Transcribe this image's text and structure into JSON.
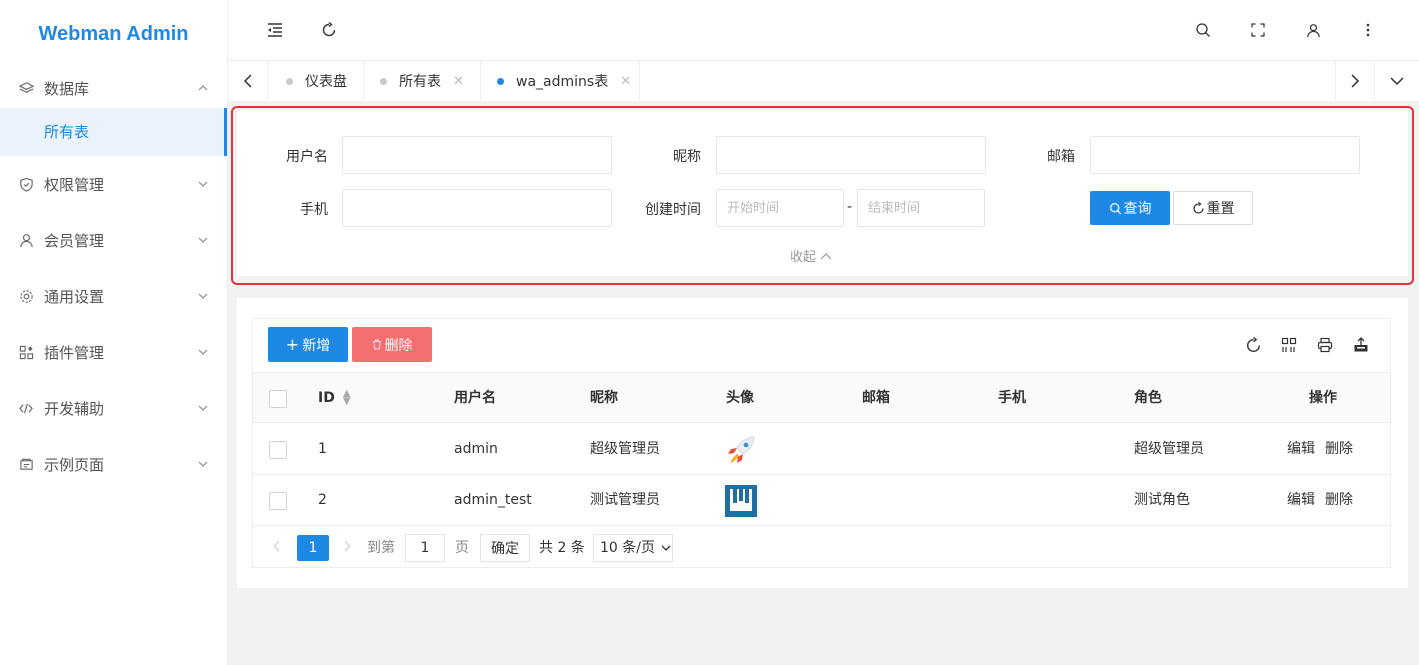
{
  "app": {
    "title": "Webman Admin"
  },
  "sidebar": {
    "items": [
      {
        "label": "数据库",
        "icon": "layers-icon",
        "expanded": true
      },
      {
        "label": "所有表",
        "sub": true,
        "active": true
      },
      {
        "label": "权限管理",
        "icon": "shield-icon"
      },
      {
        "label": "会员管理",
        "icon": "user-icon"
      },
      {
        "label": "通用设置",
        "icon": "gear-icon"
      },
      {
        "label": "插件管理",
        "icon": "plugin-icon"
      },
      {
        "label": "开发辅助",
        "icon": "code-icon"
      },
      {
        "label": "示例页面",
        "icon": "page-icon"
      }
    ]
  },
  "header": {
    "icons": [
      "menu-fold-icon",
      "refresh-icon",
      "search-icon",
      "fullscreen-icon",
      "user-icon",
      "more-icon"
    ]
  },
  "tabs": [
    {
      "label": "仪表盘",
      "closable": false,
      "active": false
    },
    {
      "label": "所有表",
      "closable": true,
      "active": false
    },
    {
      "label": "wa_admins表",
      "closable": true,
      "active": true
    }
  ],
  "search": {
    "username_label": "用户名",
    "nickname_label": "昵称",
    "email_label": "邮箱",
    "mobile_label": "手机",
    "created_label": "创建时间",
    "start_placeholder": "开始时间",
    "end_placeholder": "结束时间",
    "dash": "-",
    "query_label": "查询",
    "reset_label": "重置",
    "collapse_label": "收起"
  },
  "toolbar": {
    "add_label": "新增",
    "delete_label": "删除"
  },
  "table": {
    "columns": [
      "ID",
      "用户名",
      "昵称",
      "头像",
      "邮箱",
      "手机",
      "角色",
      "操作"
    ],
    "rows": [
      {
        "id": "1",
        "username": "admin",
        "nickname": "超级管理员",
        "avatar": "rocket-avatar",
        "email": "",
        "mobile": "",
        "role": "超级管理员"
      },
      {
        "id": "2",
        "username": "admin_test",
        "nickname": "测试管理员",
        "avatar": "plug-avatar",
        "email": "",
        "mobile": "",
        "role": "测试角色"
      }
    ],
    "edit_label": "编辑",
    "delete_label": "删除"
  },
  "pagination": {
    "current": "1",
    "goto_label": "到第",
    "goto_value": "1",
    "page_label": "页",
    "confirm_label": "确定",
    "total_label": "共 2 条",
    "per_page_label": "10 条/页"
  },
  "colors": {
    "accent": "#1e88e5",
    "danger": "#f36f6f",
    "highlight": "#e5323f"
  }
}
